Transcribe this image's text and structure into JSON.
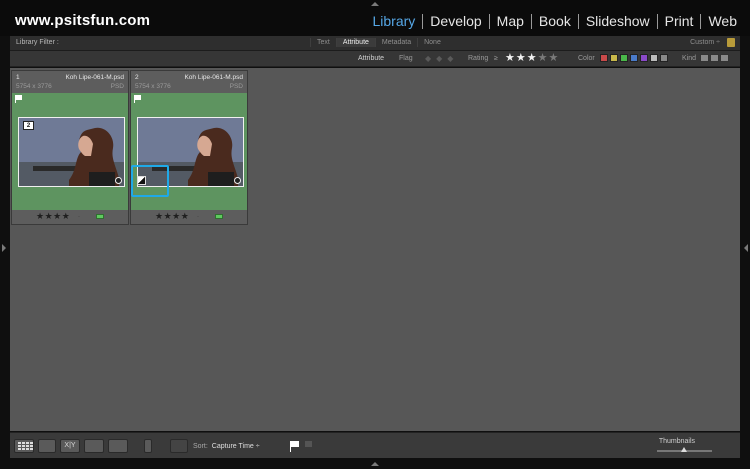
{
  "header": {
    "site": "www.psitsfun.com",
    "modules": [
      {
        "label": "Library",
        "active": true
      },
      {
        "label": "Develop",
        "active": false
      },
      {
        "label": "Map",
        "active": false
      },
      {
        "label": "Book",
        "active": false
      },
      {
        "label": "Slideshow",
        "active": false
      },
      {
        "label": "Print",
        "active": false
      },
      {
        "label": "Web",
        "active": false
      }
    ]
  },
  "filter_bar": {
    "label": "Library Filter :",
    "tabs": [
      "Text",
      "Attribute",
      "Metadata",
      "None"
    ],
    "active_tab": "Attribute",
    "preset": "Custom ÷"
  },
  "attribute_bar": {
    "title": "Attribute",
    "flag_label": "Flag",
    "rating_label": "Rating",
    "rating_op": "≥",
    "rating_stars": 3,
    "rating_max": 5,
    "color_label": "Color",
    "kind_label": "Kind",
    "swatch_colors": [
      "#c84a4a",
      "#c8b84a",
      "#4ab84a",
      "#4a7ac8",
      "#8a4ac8",
      "#bbbbbb",
      "#888888"
    ]
  },
  "grid": {
    "cells": [
      {
        "index": "1",
        "filename": "Koh Lipe-061-M.psd",
        "dims": "5754 x 3776",
        "type": "PSD",
        "stack": "2",
        "rating": "★★★★",
        "dot": "·"
      },
      {
        "index": "2",
        "filename": "Koh Lipe-061-M.psd",
        "dims": "5754 x 3776",
        "type": "PSD",
        "stack": "",
        "rating": "★★★★",
        "dot": "·"
      }
    ],
    "label_color": "#5fca5f",
    "highlight_color": "#1fa9e8"
  },
  "toolbar": {
    "sort_label": "Sort:",
    "sort_value": "Capture Time ÷",
    "thumbnails_label": "Thumbnails",
    "compare_label": "X|Y"
  }
}
